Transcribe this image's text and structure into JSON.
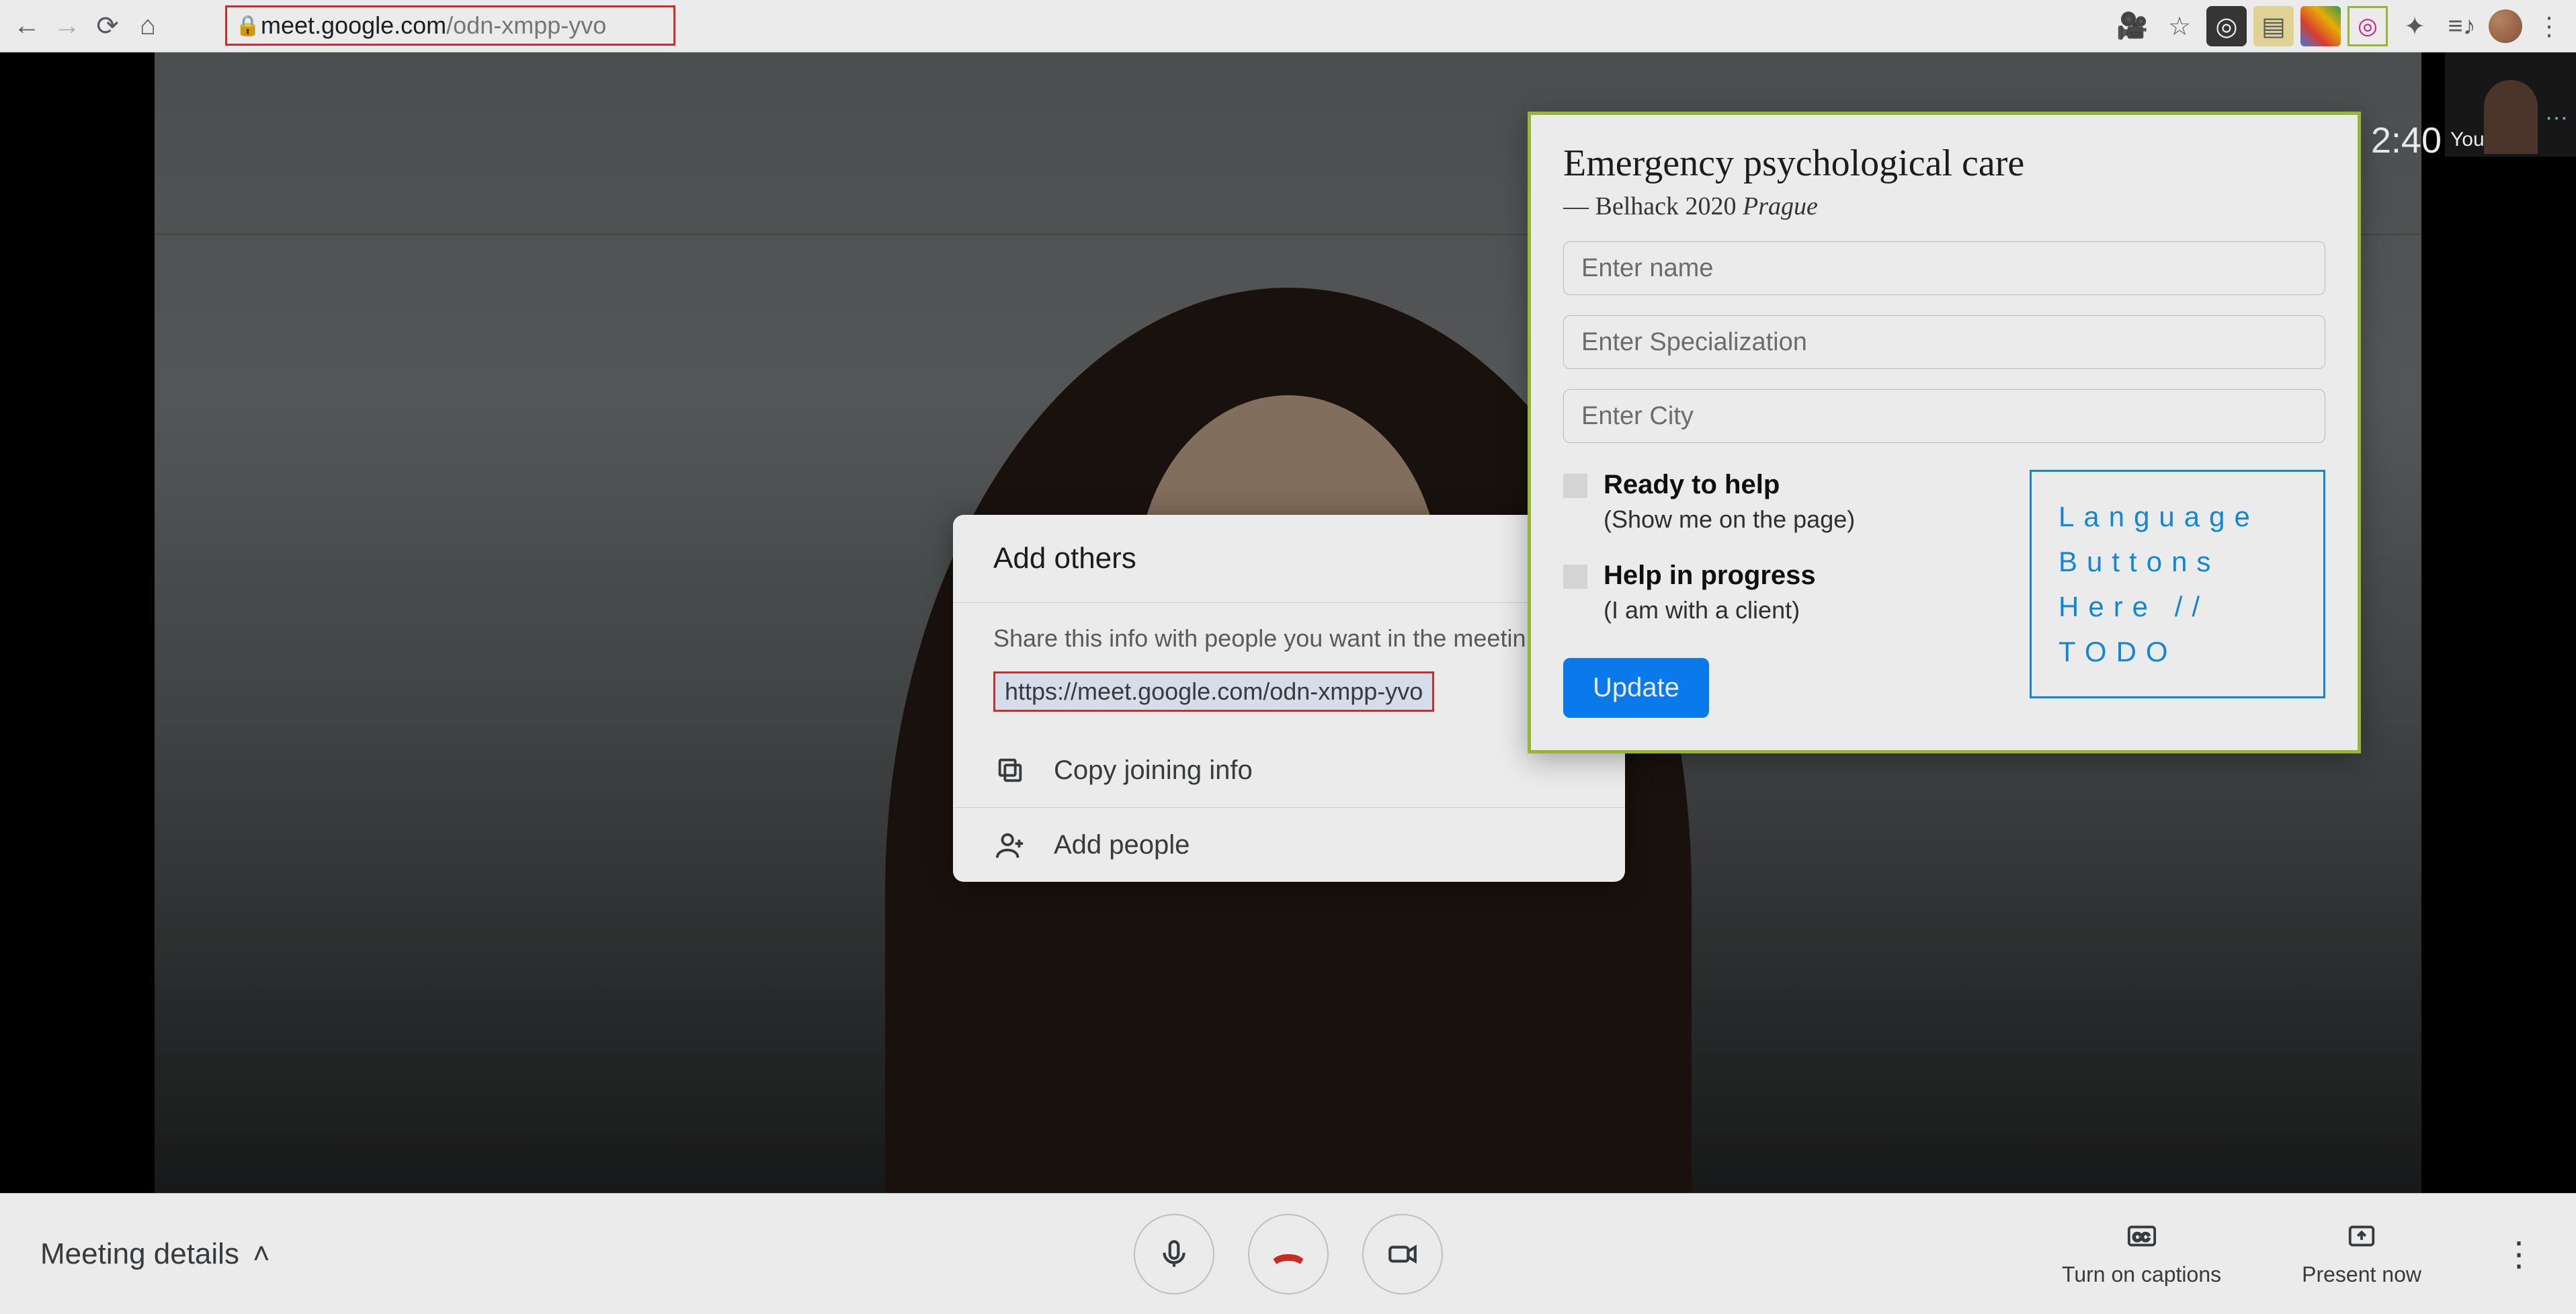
{
  "browser": {
    "url_host": "meet.google.com",
    "url_path": "/odn-xmpp-yvo"
  },
  "clock": "2:40",
  "self_view": {
    "label": "You"
  },
  "add_dialog": {
    "title": "Add others",
    "share_text": "Share this info with people you want in the meetin",
    "meet_url": "https://meet.google.com/odn-xmpp-yvo",
    "copy_label": "Copy joining info",
    "add_people_label": "Add people"
  },
  "ext": {
    "title": "Emergency psychological care",
    "sub_prefix": "— Belhack 2020 ",
    "sub_em": "Prague",
    "inputs": {
      "name_ph": "Enter name",
      "spec_ph": "Enter Specialization",
      "city_ph": "Enter City"
    },
    "ck1_label": "Ready to help",
    "ck1_sub": "(Show me on the page)",
    "ck2_label": "Help in progress",
    "ck2_sub": "(I am with a client)",
    "lang_l1": "Language",
    "lang_l2": "Buttons",
    "lang_l3": "Here // TODO",
    "update": "Update"
  },
  "bottom": {
    "meeting_details": "Meeting details",
    "captions": "Turn on captions",
    "present": "Present now"
  }
}
